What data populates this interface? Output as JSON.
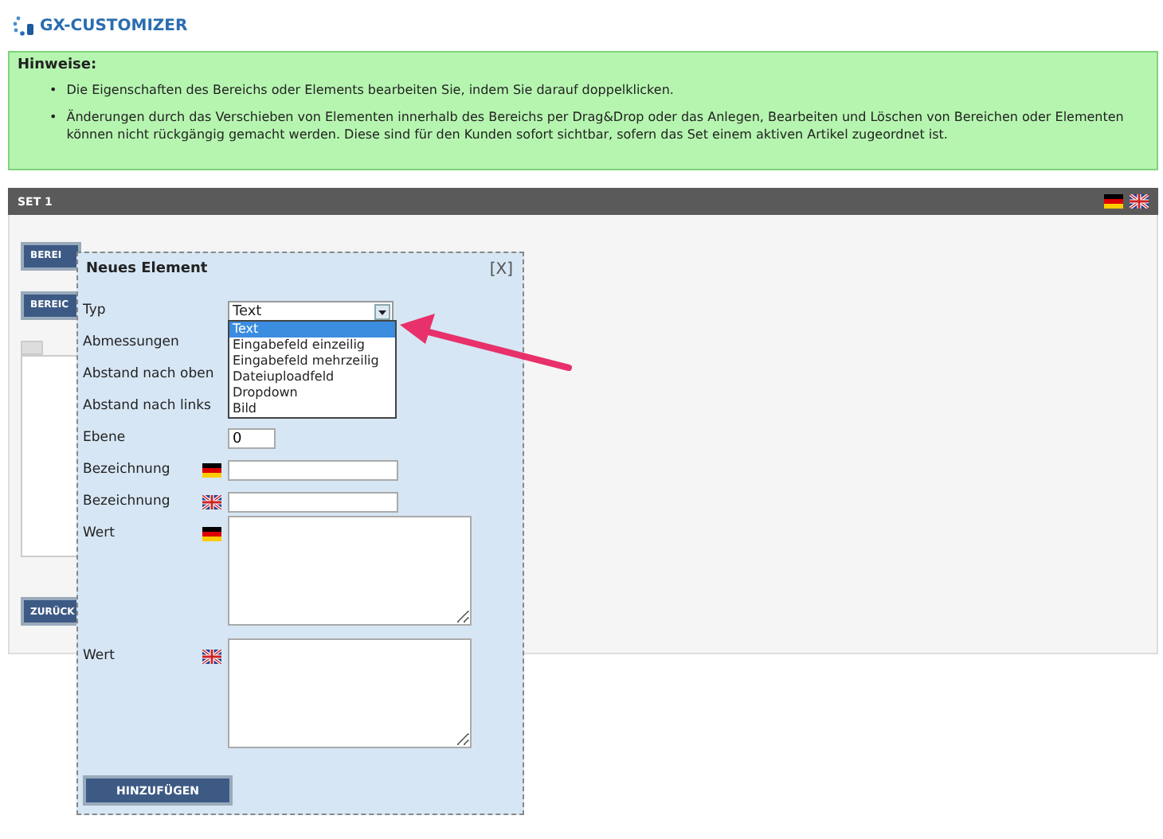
{
  "logo": {
    "text": "GX-CUSTOMIZER"
  },
  "notice": {
    "title": "Hinweise:",
    "items": [
      {
        "bullet": "•",
        "text": "Die Eigenschaften des Bereichs oder Elements bearbeiten Sie, indem Sie darauf doppelklicken."
      },
      {
        "bullet": "•",
        "text": "Änderungen durch das Verschieben von Elementen innerhalb des Bereichs per Drag&Drop oder das Anlegen, Bearbeiten und Löschen von Bereichen oder Elementen können nicht rückgängig gemacht werden. Diese sind für den Kunden sofort sichtbar, sofern das Set einem aktiven Artikel zugeordnet ist."
      }
    ]
  },
  "set": {
    "title": "SET 1",
    "flags": [
      {
        "kind": "de"
      },
      {
        "kind": "en"
      }
    ],
    "buttons": [
      "BEREI",
      "BEREIC"
    ],
    "back_button": "ZURÜCK"
  },
  "dialog": {
    "title": "Neues Element",
    "close": "[X]",
    "fields": [
      {
        "label": "Typ",
        "kind": "select",
        "value": "Text"
      },
      {
        "label": "Abmessungen",
        "kind": "covered"
      },
      {
        "label": "Abstand nach oben",
        "kind": "covered"
      },
      {
        "label": "Abstand nach links",
        "kind": "covered"
      },
      {
        "label": "Ebene",
        "kind": "short",
        "value": "0"
      },
      {
        "label": "Bezeichnung",
        "kind": "text",
        "flag": {
          "kind": "de"
        }
      },
      {
        "label": "Bezeichnung",
        "kind": "text",
        "flag": {
          "kind": "en"
        }
      },
      {
        "label": "Wert",
        "kind": "textarea",
        "flag": {
          "kind": "de"
        }
      },
      {
        "label": "Wert",
        "kind": "textarea",
        "flag": {
          "kind": "en"
        }
      }
    ],
    "options": [
      {
        "label": "Text",
        "selected": true
      },
      {
        "label": "Eingabefeld einzeilig",
        "selected": false
      },
      {
        "label": "Eingabefeld mehrzeilig",
        "selected": false
      },
      {
        "label": "Dateiuploadfeld",
        "selected": false
      },
      {
        "label": "Dropdown",
        "selected": false
      },
      {
        "label": "Bild",
        "selected": false
      }
    ],
    "submit": "HINZUFÜGEN"
  }
}
